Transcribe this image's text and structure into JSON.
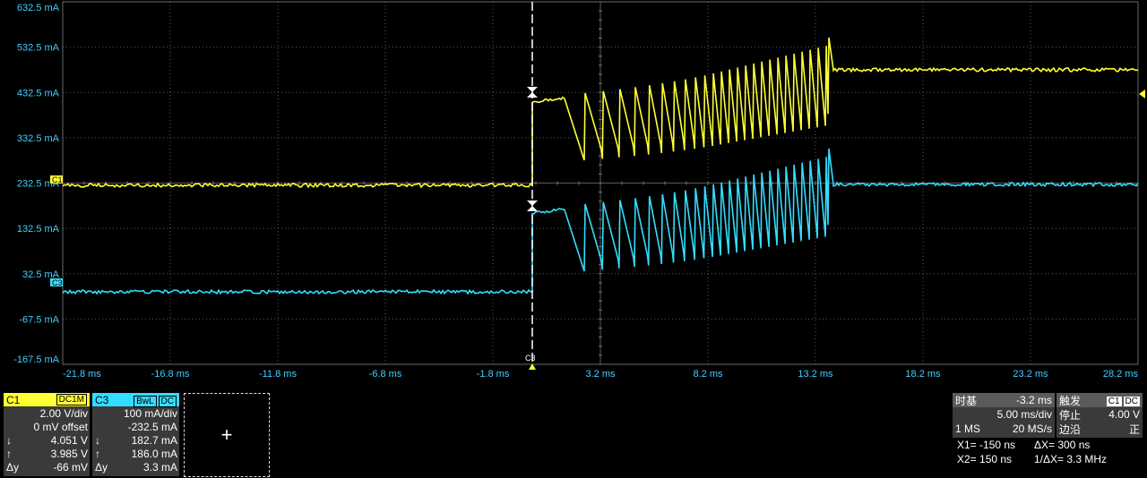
{
  "plot": {
    "y_ticks": [
      "632.5 mA",
      "532.5 mA",
      "432.5 mA",
      "332.5 mA",
      "232.5 mA",
      "132.5 mA",
      "32.5 mA",
      "-67.5 mA",
      "-167.5 mA"
    ],
    "x_ticks": [
      "-21.8 ms",
      "-16.8 ms",
      "-11.8 ms",
      "-6.8 ms",
      "-1.8 ms",
      "3.2 ms",
      "8.2 ms",
      "13.2 ms",
      "18.2 ms",
      "23.2 ms",
      "28.2 ms"
    ],
    "c1_marker": "C1",
    "c3_marker": "C3",
    "trigger_marker": "C3"
  },
  "ch1": {
    "label": "C1",
    "coupling": "DC1M",
    "vdiv": "2.00 V/div",
    "offset": "0 mV offset",
    "down_sym": "↓",
    "down": "4.051 V",
    "up_sym": "↑",
    "up": "3.985 V",
    "dy_label": "Δy",
    "dy": "-66 mV"
  },
  "ch3": {
    "label": "C3",
    "bw": "BwL",
    "coupling": "DC",
    "vdiv": "100 mA/div",
    "offset": "-232.5 mA",
    "down_sym": "↓",
    "down": "182.7 mA",
    "up_sym": "↑",
    "up": "186.0 mA",
    "dy_label": "Δy",
    "dy": "3.3 mA"
  },
  "add_channel": "+",
  "timebase": {
    "label": "时基",
    "delay": "-3.2 ms",
    "div": "5.00 ms/div",
    "mem": "1 MS",
    "rate": "20 MS/s"
  },
  "trigger": {
    "label": "触发",
    "src": "C1",
    "coupling": "DC",
    "mode": "停止",
    "level": "4.00 V",
    "edge_label": "边沿",
    "slope": "正"
  },
  "cursors": {
    "x1": "X1=  -150 ns",
    "dx": "ΔX=    300 ns",
    "x2": "X2=   150 ns",
    "inv": "1/ΔX=  3.3 MHz"
  },
  "colors": {
    "ch1": "#ffff33",
    "ch3": "#33ddff",
    "grid": "#6a6a6a"
  }
}
